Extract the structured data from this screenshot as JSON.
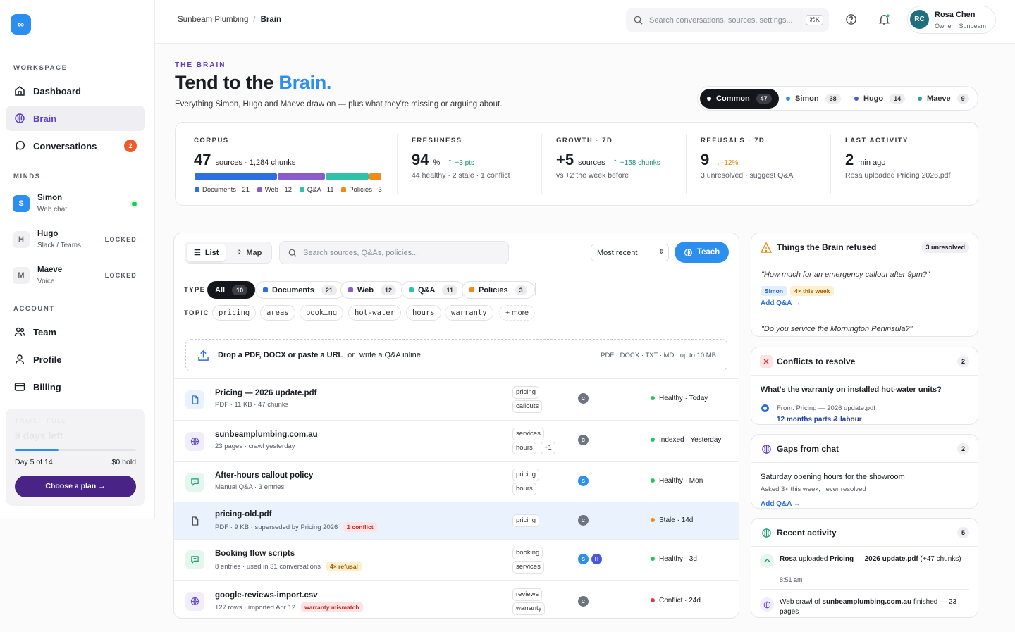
{
  "app": {
    "logo": "∞"
  },
  "sidebar": {
    "workspace_label": "WORKSPACE",
    "nav": [
      {
        "label": "Dashboard",
        "icon": "home-icon"
      },
      {
        "label": "Brain",
        "icon": "brain-icon"
      },
      {
        "label": "Conversations",
        "icon": "chat-icon",
        "badge": "2"
      }
    ],
    "minds_label": "MINDS",
    "minds": [
      {
        "initial": "S",
        "name": "Simon",
        "channel": "Web chat",
        "status": "online"
      },
      {
        "initial": "H",
        "name": "Hugo",
        "channel": "Slack / Teams",
        "status": "LOCKED"
      },
      {
        "initial": "M",
        "name": "Maeve",
        "channel": "Voice",
        "status": "LOCKED"
      }
    ],
    "account_label": "ACCOUNT",
    "account": [
      {
        "label": "Team",
        "icon": "team-icon"
      },
      {
        "label": "Profile",
        "icon": "user-icon"
      },
      {
        "label": "Billing",
        "icon": "card-icon"
      }
    ],
    "trial": {
      "ghost_label": "TRIAL · FULL",
      "ghost_days": "9 days left",
      "progress": 0.36,
      "day": "Day 5 of 14",
      "hold": "$0 hold",
      "cta": "Choose a plan →"
    }
  },
  "topbar": {
    "org": "Sunbeam Plumbing",
    "page": "Brain",
    "search_placeholder": "Search conversations, sources, settings...",
    "shortcut": "⌘K",
    "user": {
      "initials": "RC",
      "name": "Rosa Chen",
      "role": "Owner · Sunbeam"
    }
  },
  "hero": {
    "eyebrow": "THE BRAIN",
    "title_pre": "Tend to the ",
    "title_hl": "Brain.",
    "subtitle": "Everything Simon, Hugo and Maeve draw on — plus what they're missing or arguing about.",
    "mind_tabs": [
      {
        "label": "Common",
        "count": "47",
        "color": "#ffffff",
        "active": true
      },
      {
        "label": "Simon",
        "count": "38",
        "color": "#2c8ff0"
      },
      {
        "label": "Hugo",
        "count": "14",
        "color": "#4a57d8"
      },
      {
        "label": "Maeve",
        "count": "9",
        "color": "#2aa3a0"
      }
    ]
  },
  "stats": {
    "corpus": {
      "label": "CORPUS",
      "value": "47",
      "unit": "sources · 1,284 chunks",
      "legend": [
        {
          "label": "Documents · 21",
          "color": "#2b6fe0",
          "value": 21
        },
        {
          "label": "Web · 12",
          "color": "#8a5cc9",
          "value": 12
        },
        {
          "label": "Q&A · 11",
          "color": "#2fc2a8",
          "value": 11
        },
        {
          "label": "Policies · 3",
          "color": "#f08a18",
          "value": 3
        }
      ]
    },
    "freshness": {
      "label": "FRESHNESS",
      "value": "94",
      "unit": "%",
      "delta": "+3 pts",
      "caption": "44 healthy · 2 stale · 1 conflict"
    },
    "growth": {
      "label": "GROWTH · 7D",
      "value": "+5",
      "unit": "sources",
      "delta": "+158 chunks",
      "caption": "vs +2 the week before"
    },
    "refusals": {
      "label": "REFUSALS · 7D",
      "value": "9",
      "delta": "-12%",
      "caption": "3 unresolved · suggest Q&A"
    },
    "activity": {
      "label": "LAST ACTIVITY",
      "value": "2",
      "unit": "min ago",
      "caption": "Rosa uploaded Pricing 2026.pdf"
    }
  },
  "sources": {
    "view": {
      "list": "List",
      "map": "Map"
    },
    "search_placeholder": "Search sources, Q&As, policies...",
    "sort": "Most recent",
    "teach": "Teach",
    "type_label": "TYPE",
    "types": [
      {
        "label": "All",
        "count": "10",
        "active": true
      },
      {
        "label": "Documents",
        "count": "21",
        "color": "#2b6fe0"
      },
      {
        "label": "Web",
        "count": "12",
        "color": "#8a5cc9"
      },
      {
        "label": "Q&A",
        "count": "11",
        "color": "#2fc2a8"
      },
      {
        "label": "Policies",
        "count": "3",
        "color": "#f08a18"
      }
    ],
    "topic_label": "TOPIC",
    "topics": [
      "pricing",
      "areas",
      "booking",
      "hot-water",
      "hours",
      "warranty"
    ],
    "topics_more": "+ more",
    "drop": {
      "strong": "Drop a PDF, DOCX or paste a URL",
      "or": "or",
      "alt": "write a Q&A inline",
      "formats": "PDF · DOCX · TXT · MD · up to 10 MB"
    },
    "rows": [
      {
        "icon": "file-icon",
        "title": "Pricing — 2026 update.pdf",
        "meta": "PDF · 11 KB · 47 chunks",
        "tags": [
          "pricing",
          "callouts"
        ],
        "avatars": [
          "C"
        ],
        "status": "Healthy",
        "when": "Today",
        "status_color": "#22c55e"
      },
      {
        "icon": "globe-icon",
        "title": "sunbeamplumbing.com.au",
        "meta": "23 pages · crawl yesterday",
        "tags": [
          "services",
          "hours",
          "+1"
        ],
        "avatars": [
          "C"
        ],
        "status": "Indexed",
        "when": "Yesterday",
        "status_color": "#22c55e"
      },
      {
        "icon": "chat-bubble-icon",
        "title": "After-hours callout policy",
        "meta": "Manual Q&A · 3 entries",
        "tags": [
          "pricing",
          "hours"
        ],
        "avatars": [
          "S"
        ],
        "status": "Healthy",
        "when": "Mon",
        "status_color": "#22c55e"
      },
      {
        "icon": "file-icon",
        "title": "pricing-old.pdf",
        "meta": "PDF · 9 KB · superseded by Pricing 2026",
        "flag": "1 conflict",
        "flag_type": "red",
        "tags": [
          "pricing"
        ],
        "avatars": [
          "C"
        ],
        "status": "Stale",
        "when": "14d",
        "status_color": "#f08a18"
      },
      {
        "icon": "chat-bubble-icon",
        "title": "Booking flow scripts",
        "meta": "8 entries · used in 31 conversations",
        "flag": "4× refusal",
        "flag_type": "amb",
        "tags": [
          "booking",
          "services"
        ],
        "avatars": [
          "S",
          "H"
        ],
        "status": "Healthy",
        "when": "3d",
        "status_color": "#22c55e"
      },
      {
        "icon": "globe-icon",
        "title": "google-reviews-import.csv",
        "meta": "127 rows · imported Apr 12",
        "flag": "warranty mismatch",
        "flag_type": "red",
        "tags": [
          "reviews",
          "warranty"
        ],
        "avatars": [
          "C"
        ],
        "status": "Conflict",
        "when": "24d",
        "status_color": "#e53935"
      }
    ]
  },
  "refused": {
    "title": "Things the Brain refused",
    "count": "3 unresolved",
    "q1": "\"How much for an emergency callout after 9pm?\"",
    "mind": "Simon",
    "freq": "4× this week",
    "add": "Add Q&A →",
    "q2": "\"Do you service the Mornington Peninsula?\""
  },
  "conflicts": {
    "title": "Conflicts to resolve",
    "count": "2",
    "question": "What's the warranty on installed hot-water units?",
    "from": "From: Pricing — 2026 update.pdf",
    "answer": "12 months parts & labour"
  },
  "gaps": {
    "title": "Gaps from chat",
    "count": "2",
    "item": "Saturday opening hours for the showroom",
    "meta": "Asked 3× this week, never resolved",
    "add": "Add Q&A →"
  },
  "recent": {
    "title": "Recent activity",
    "count": "5",
    "a1_pre": "Rosa",
    "a1_mid": " uploaded ",
    "a1_file": "Pricing — 2026 update.pdf",
    "a1_post": " (+47 chunks)",
    "a1_time": "8:51 am",
    "a2_pre": "Web crawl of ",
    "a2_site": "sunbeamplumbing.com.au",
    "a2_post": " finished — 23 pages"
  }
}
